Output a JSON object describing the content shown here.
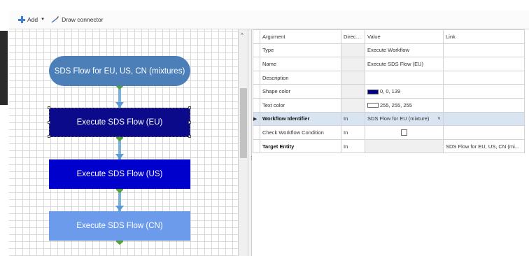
{
  "toolbar": {
    "add_label": "Add",
    "draw_connector_label": "Draw connector"
  },
  "canvas": {
    "nodes": [
      {
        "label": "SDS Flow for EU, US, CN (mixtures)",
        "color": "#4c7fb8"
      },
      {
        "label": "Execute SDS Flow (EU)",
        "color": "#0a0a8a"
      },
      {
        "label": "Execute SDS Flow (US)",
        "color": "#0000cd"
      },
      {
        "label": "Execute SDS Flow (CN)",
        "color": "#6b9bea"
      }
    ]
  },
  "properties": {
    "headers": {
      "argument": "Argument",
      "direction": "Direction",
      "value": "Value",
      "link": "Link"
    },
    "rows": [
      {
        "argument": "Type",
        "direction": "",
        "value": "Execute Workflow",
        "link": ""
      },
      {
        "argument": "Name",
        "direction": "",
        "value": "Execute SDS Flow (EU)",
        "link": ""
      },
      {
        "argument": "Description",
        "direction": "",
        "value": "",
        "link": ""
      },
      {
        "argument": "Shape color",
        "direction": "",
        "value": "0, 0, 139",
        "link": "",
        "swatch": "#00008b"
      },
      {
        "argument": "Text color",
        "direction": "",
        "value": "255, 255, 255",
        "link": "",
        "swatch": "#ffffff"
      },
      {
        "argument": "Workflow Identifier",
        "direction": "In",
        "value": "SDS Flow for EU (mixture)",
        "link": ""
      },
      {
        "argument": "Check Workflow Condition",
        "direction": "In",
        "value": "",
        "link": ""
      },
      {
        "argument": "Target Entity",
        "direction": "In",
        "value": "",
        "link": "SDS Flow for EU, US, CN (mi..."
      }
    ]
  }
}
